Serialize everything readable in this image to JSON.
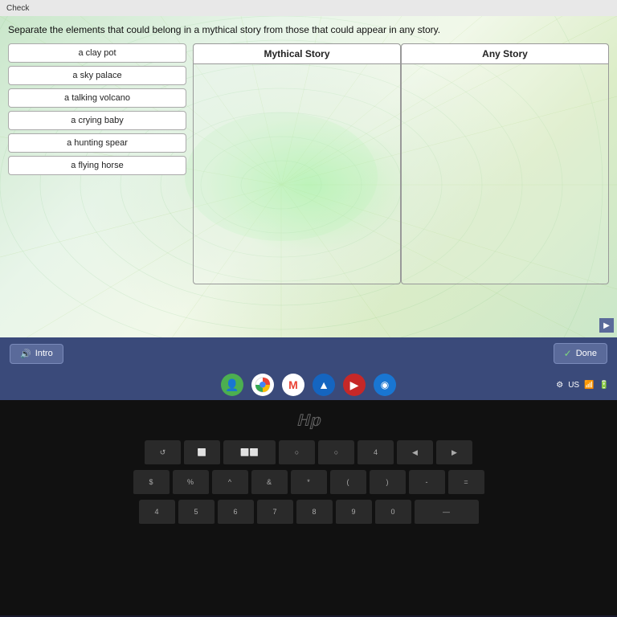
{
  "header": {
    "check_label": "Check"
  },
  "instruction": "Separate the elements that could belong in a mythical story from those that could appear in any story.",
  "items": [
    {
      "id": "clay-pot",
      "label": "a clay pot"
    },
    {
      "id": "sky-palace",
      "label": "a sky palace"
    },
    {
      "id": "talking-volcano",
      "label": "a talking volcano"
    },
    {
      "id": "crying-baby",
      "label": "a crying baby"
    },
    {
      "id": "hunting-spear",
      "label": "a hunting spear"
    },
    {
      "id": "flying-horse",
      "label": "a flying horse"
    }
  ],
  "drop_zones": [
    {
      "id": "mythical",
      "label": "Mythical Story"
    },
    {
      "id": "any",
      "label": "Any Story"
    }
  ],
  "toolbar": {
    "intro_label": "Intro",
    "done_label": "Done"
  },
  "taskbar": {
    "icons": [
      {
        "id": "files",
        "symbol": "👤",
        "class": "green"
      },
      {
        "id": "chrome",
        "symbol": "⊕",
        "class": "chrome"
      },
      {
        "id": "gmail",
        "symbol": "M",
        "class": "gmail"
      },
      {
        "id": "drive",
        "symbol": "▲",
        "class": "blue"
      },
      {
        "id": "youtube",
        "symbol": "▶",
        "class": "red"
      },
      {
        "id": "meet",
        "symbol": "◉",
        "class": "meet"
      }
    ],
    "right_info": "US"
  },
  "keyboard": {
    "row1": [
      "↺",
      "⬜",
      "⬜⬜",
      "○",
      "○",
      "4",
      "◀",
      "▶"
    ],
    "row2": [
      "$",
      "%",
      "^",
      "&",
      "*",
      "(",
      ")",
      "-",
      "="
    ],
    "row3": [
      "4",
      "5",
      "6",
      "7",
      "8",
      "9",
      "0",
      "—"
    ]
  }
}
